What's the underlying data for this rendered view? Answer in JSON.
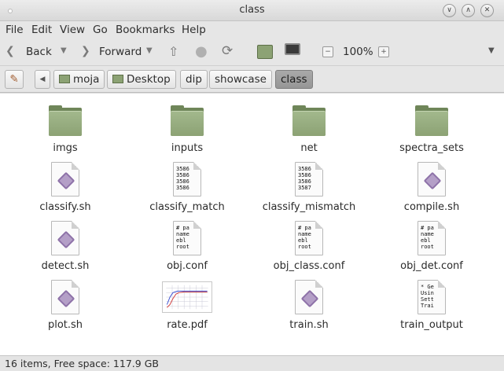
{
  "window": {
    "title": "class"
  },
  "menu": [
    "File",
    "Edit",
    "View",
    "Go",
    "Bookmarks",
    "Help"
  ],
  "toolbar": {
    "back_label": "Back",
    "forward_label": "Forward",
    "zoom_label": "100%"
  },
  "breadcrumbs": [
    "moja",
    "Desktop",
    "dip",
    "showcase",
    "class"
  ],
  "items": [
    {
      "name": "imgs",
      "type": "folder"
    },
    {
      "name": "inputs",
      "type": "folder"
    },
    {
      "name": "net",
      "type": "folder"
    },
    {
      "name": "spectra_sets",
      "type": "folder"
    },
    {
      "name": "classify.sh",
      "type": "script"
    },
    {
      "name": "classify_match",
      "type": "text",
      "preview": "3586\n3586\n3586\n3586"
    },
    {
      "name": "classify_mismatch",
      "type": "text",
      "preview": "3586\n3586\n3586\n3587"
    },
    {
      "name": "compile.sh",
      "type": "script"
    },
    {
      "name": "detect.sh",
      "type": "script"
    },
    {
      "name": "obj.conf",
      "type": "text",
      "preview": "# pa\nname\nebl\nroot"
    },
    {
      "name": "obj_class.conf",
      "type": "text",
      "preview": "# pa\nname\nebl\nroot"
    },
    {
      "name": "obj_det.conf",
      "type": "text",
      "preview": "# pa\nname\nebl\nroot"
    },
    {
      "name": "plot.sh",
      "type": "script"
    },
    {
      "name": "rate.pdf",
      "type": "pdf"
    },
    {
      "name": "train.sh",
      "type": "script"
    },
    {
      "name": "train_output",
      "type": "text",
      "preview": "* Ge\nUsin\nSett\nTrai"
    }
  ],
  "status": "16 items, Free space: 117.9 GB",
  "colors": {
    "folder": "#8ca274",
    "folder_dark": "#6f8659",
    "script_mark": "#b49fc7",
    "active_crumb": "#9e9e9e"
  }
}
